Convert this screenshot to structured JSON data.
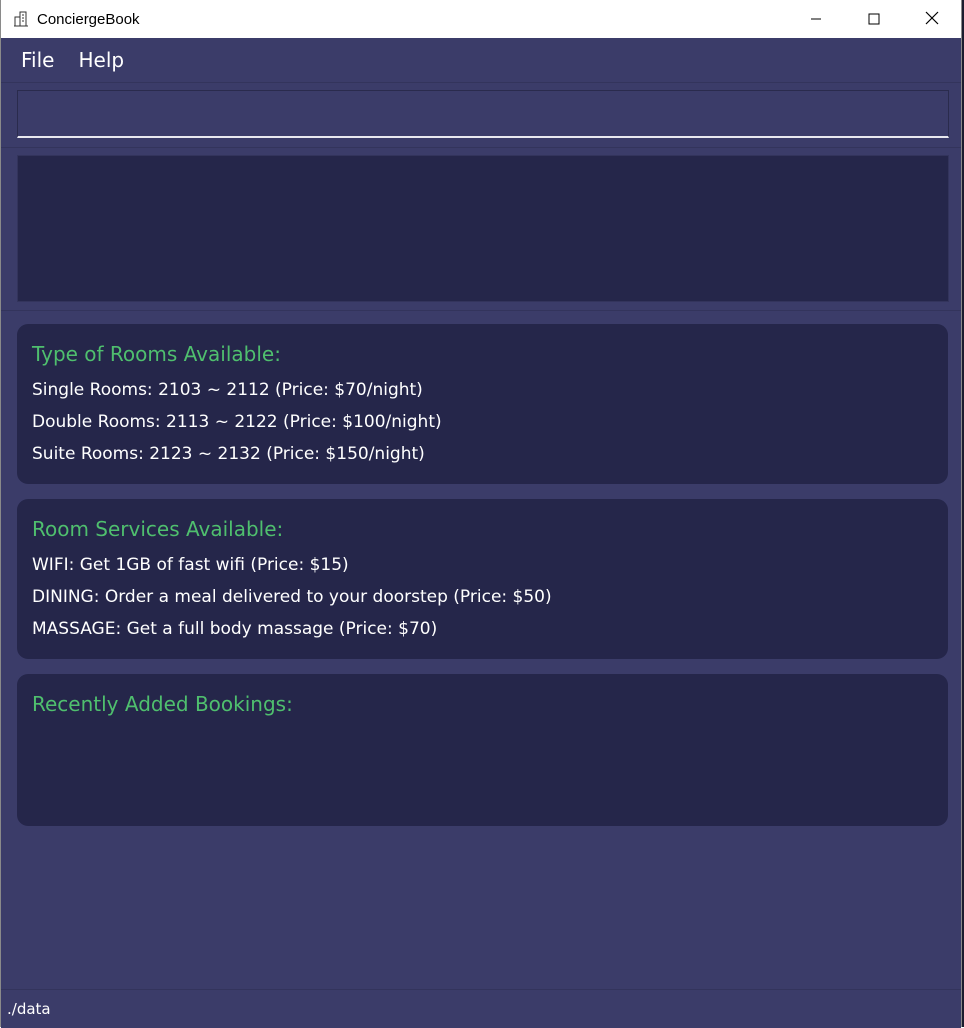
{
  "window": {
    "title": "ConciergeBook",
    "controls": {
      "minimize": "minimize-icon",
      "maximize": "maximize-icon",
      "close": "close-icon"
    }
  },
  "menu": {
    "items": [
      {
        "label": "File"
      },
      {
        "label": "Help"
      }
    ]
  },
  "command": {
    "value": "",
    "placeholder": ""
  },
  "result": {
    "text": ""
  },
  "rooms": {
    "title": "Type of Rooms Available:",
    "lines": [
      "Single Rooms: 2103 ~ 2112 (Price: $70/night)",
      "Double Rooms: 2113 ~ 2122 (Price: $100/night)",
      "Suite Rooms: 2123 ~ 2132 (Price: $150/night)"
    ]
  },
  "services": {
    "title": "Room Services Available:",
    "lines": [
      "WIFI: Get 1GB of fast wifi (Price: $15)",
      "DINING: Order a meal delivered to your doorstep (Price: $50)",
      "MASSAGE: Get a full body massage (Price: $70)"
    ]
  },
  "bookings": {
    "title": "Recently Added Bookings:",
    "lines": []
  },
  "status": {
    "path": "./data"
  },
  "colors": {
    "background": "#3b3c69",
    "panel": "#25264a",
    "heading": "#4fbf6e",
    "text": "#ffffff"
  }
}
